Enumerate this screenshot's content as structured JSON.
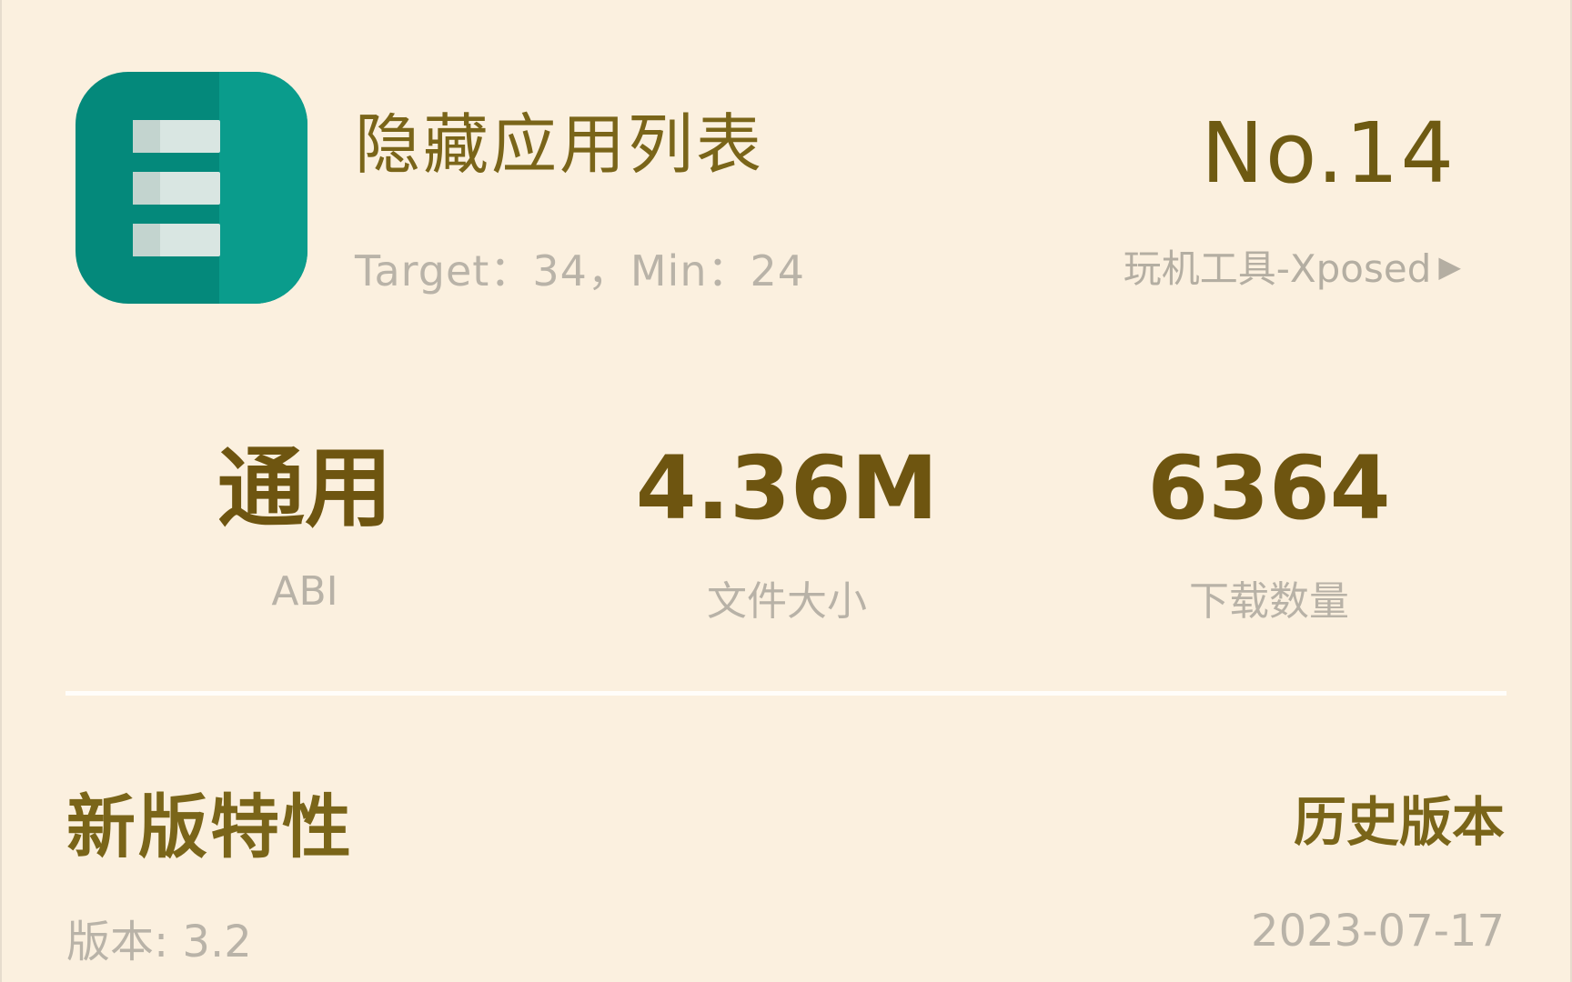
{
  "app": {
    "name": "隐藏应用列表",
    "target_line": "Target：34，Min：24",
    "rank": "No.14",
    "category": "玩机工具-Xposed",
    "icon_name": "list-app-icon"
  },
  "stats": [
    {
      "value": "通用",
      "label": "ABI"
    },
    {
      "value": "4.36M",
      "label": "文件大小"
    },
    {
      "value": "6364",
      "label": "下载数量"
    }
  ],
  "changelog": {
    "title": "新版特性",
    "history_link": "历史版本",
    "version": "版本: 3.2",
    "date": "2023-07-17"
  },
  "colors": {
    "background": "#fbf0df",
    "accent": "#7a6519",
    "muted": "#b9b3a8",
    "icon_primary": "#04897b"
  }
}
